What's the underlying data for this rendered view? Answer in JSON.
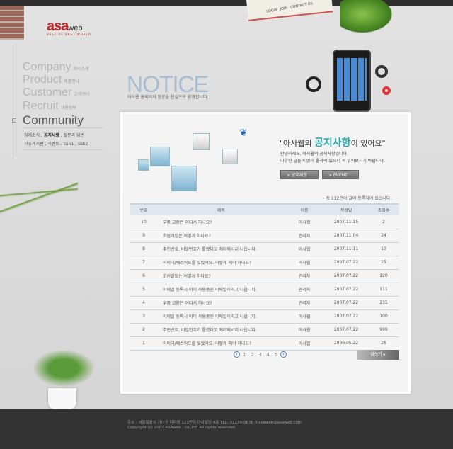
{
  "brand": {
    "logo_main": "asa",
    "logo_sub": "web",
    "tagline": "BEST OF BEST WORLD"
  },
  "top_nav": [
    "LOGIN",
    "JOIN",
    "CONTACT US"
  ],
  "menu": [
    {
      "en": "Company",
      "ko": "회사소개"
    },
    {
      "en": "Product",
      "ko": "제품안내"
    },
    {
      "en": "Customer",
      "ko": "고객센터"
    },
    {
      "en": "Recruit",
      "ko": "채용정보"
    },
    {
      "en": "Community",
      "ko": ""
    }
  ],
  "submenu": {
    "line1_a": "업계소식 , ",
    "line1_active": "공지사항",
    "line1_b": " , 질문과 답변",
    "line2": "자유게시판 , 이벤트 , sub1 , sub2"
  },
  "page": {
    "title": "NOTICE",
    "subtitle": "아사웹 홈페이지 방문을 진심으로 환영합니다."
  },
  "intro": {
    "headline_a": "\"아사웹의 ",
    "headline_b": "공지사항",
    "headline_c": "이 있어요\"",
    "line1": "안녕하세요. 아사웹의 공지사항입니다.",
    "line2": "다양한 글들이 많이 올라와 있으니 꼭 읽어보시기 바랍니다.",
    "btn_notice": "> 공지사항",
    "btn_event": "> EVENT"
  },
  "total": "• 총 112건의 글이 등록되어 있습니다.",
  "table": {
    "headers": [
      "번호",
      "제목",
      "이름",
      "작성일",
      "조회수"
    ],
    "rows": [
      [
        "10",
        "부품 교환은 어디서 하나요?",
        "아사웹",
        "2007.11.15",
        "2"
      ],
      [
        "9",
        "회원가입은 어떻게 하나요?",
        "관리자",
        "2007.11.04",
        "24"
      ],
      [
        "8",
        "주민번호, 비밀번호가 틀렸다고 에러메시지 나옵니다.",
        "아사웹",
        "2007.11.11",
        "10"
      ],
      [
        "7",
        "아이디/패스워드를 잊었어요. 어떻게 해야 하나요?",
        "아사웹",
        "2007.07.22",
        "25"
      ],
      [
        "6",
        "회원탈퇴는 어떻게 하나요?",
        "관리자",
        "2007.07.22",
        "120"
      ],
      [
        "5",
        "이메일 등록시 이미 사용중인 이메일이라고 나옵니다.",
        "관리자",
        "2007.07.22",
        "111"
      ],
      [
        "4",
        "부품 교환은 어디서 하나요?",
        "관리자",
        "2007.07.22",
        "235"
      ],
      [
        "3",
        "이메일 등록시 이미 사용중인 이메일이라고 나옵니다.",
        "아사웹",
        "2007.07.22",
        "100"
      ],
      [
        "2",
        "주민번호, 비밀번호가 틀렸다고 에러메시지 나옵니다.",
        "아사웹",
        "2007.07.22",
        "999"
      ],
      [
        "1",
        "아이디/패스워드를 잊었어요. 어떻게 해야 하나요?",
        "아사웹",
        "2006.05.22",
        "26"
      ]
    ]
  },
  "pagination": {
    "prev": "‹",
    "pages": "1 . 2 . 3 . 4 . 5",
    "next": "›"
  },
  "write_button": "글쓰기 ▸",
  "footer": {
    "address": "주소 : 서울특별시 가나구 다라동 123번지 아사빌딩 4층 TEL: 01234-5678-9 asaweb@asaweb.com",
    "copyright": "Copyright (c) 2007 ASAweb . co.,ltd. All rights reserved."
  }
}
